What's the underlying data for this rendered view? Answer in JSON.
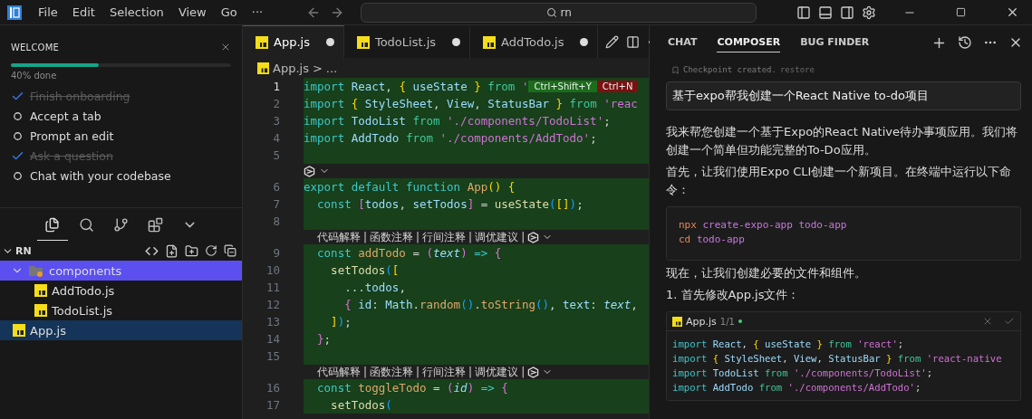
{
  "title_bar": {
    "menu": [
      "File",
      "Edit",
      "Selection",
      "View",
      "Go",
      "···"
    ],
    "search": {
      "value": "rn"
    }
  },
  "welcome": {
    "title": "WELCOME",
    "progress": {
      "level": 0.4,
      "reading": "40% done"
    },
    "tasks": [
      {
        "label": "Finish onboarding",
        "done": true
      },
      {
        "label": "Accept a tab",
        "done": false
      },
      {
        "label": "Prompt an edit",
        "done": false
      },
      {
        "label": "Ask a question",
        "done": true
      },
      {
        "label": "Chat with your codebase",
        "done": false
      }
    ]
  },
  "activity_tabs": [
    {
      "kind": "files",
      "selected": true
    },
    {
      "kind": "search",
      "selected": false
    },
    {
      "kind": "source-control",
      "selected": false
    },
    {
      "kind": "extensions",
      "selected": false
    },
    {
      "kind": "more",
      "selected": false
    }
  ],
  "explorer": {
    "title": "RN",
    "expanded": true,
    "tree": [
      {
        "label": "components",
        "kind": "folder",
        "expanded": true,
        "selected": true,
        "active": false,
        "children": [
          {
            "label": "AddTodo.js",
            "kind": "js",
            "selected": false,
            "active": false
          },
          {
            "label": "TodoList.js",
            "kind": "js",
            "selected": false,
            "active": false
          }
        ]
      },
      {
        "label": "App.js",
        "kind": "js",
        "selected": false,
        "active": true
      }
    ]
  },
  "editor": {
    "tabs": [
      {
        "label": "App.js",
        "selected": true,
        "modified": true
      },
      {
        "label": "TodoList.js",
        "selected": false,
        "modified": true
      },
      {
        "label": "AddTodo.js",
        "selected": false,
        "modified": true
      }
    ],
    "breadcrumb": {
      "file": "App.js",
      "separator": ">",
      "rest": "..."
    },
    "lines": [
      {
        "kind": "code",
        "number": "1",
        "current": true,
        "added": true,
        "tokens": [
          {
            "t": "import ",
            "kind": "kw"
          },
          {
            "t": "React",
            "kind": "id"
          },
          {
            "t": ", ",
            "kind": "plain"
          },
          {
            "t": "{ ",
            "kind": "p1"
          },
          {
            "t": "useState ",
            "kind": "id"
          },
          {
            "t": "} ",
            "kind": "p1"
          },
          {
            "t": "from ",
            "kind": "from"
          },
          {
            "t": "'",
            "kind": "str"
          }
        ],
        "badges": [
          {
            "label": "Ctrl+Shift+Y",
            "kind": "accept"
          },
          {
            "label": "Ctrl+N",
            "kind": "reject"
          }
        ]
      },
      {
        "kind": "code",
        "number": "2",
        "current": false,
        "added": true,
        "tokens": [
          {
            "t": "import ",
            "kind": "kw"
          },
          {
            "t": "{ ",
            "kind": "p1"
          },
          {
            "t": "StyleSheet",
            "kind": "id"
          },
          {
            "t": ", ",
            "kind": "plain"
          },
          {
            "t": "View",
            "kind": "id"
          },
          {
            "t": ", ",
            "kind": "plain"
          },
          {
            "t": "StatusBar ",
            "kind": "id"
          },
          {
            "t": "} ",
            "kind": "p1"
          },
          {
            "t": "from ",
            "kind": "from"
          },
          {
            "t": "'reac",
            "kind": "str"
          }
        ]
      },
      {
        "kind": "code",
        "number": "3",
        "current": false,
        "added": true,
        "tokens": [
          {
            "t": "import ",
            "kind": "kw"
          },
          {
            "t": "TodoList ",
            "kind": "id"
          },
          {
            "t": "from ",
            "kind": "from"
          },
          {
            "t": "'./components/TodoList'",
            "kind": "str"
          },
          {
            "t": ";",
            "kind": "plain"
          }
        ]
      },
      {
        "kind": "code",
        "number": "4",
        "current": false,
        "added": true,
        "tokens": [
          {
            "t": "import ",
            "kind": "kw"
          },
          {
            "t": "AddTodo ",
            "kind": "id"
          },
          {
            "t": "from ",
            "kind": "from"
          },
          {
            "t": "'./components/AddTodo'",
            "kind": "str"
          },
          {
            "t": ";",
            "kind": "plain"
          }
        ]
      },
      {
        "kind": "code",
        "number": "5",
        "current": false,
        "added": true
      },
      {
        "kind": "ai_marker"
      },
      {
        "kind": "code",
        "number": "6",
        "current": false,
        "added": true,
        "tokens": [
          {
            "t": "export default function ",
            "kind": "kw"
          },
          {
            "t": "App",
            "kind": "fn"
          },
          {
            "t": "() {",
            "kind": "p1"
          }
        ]
      },
      {
        "kind": "code",
        "number": "7",
        "current": false,
        "added": true,
        "tokens": [
          {
            "t": "  const ",
            "kind": "kw"
          },
          {
            "t": "[",
            "kind": "p2"
          },
          {
            "t": "todos",
            "kind": "id"
          },
          {
            "t": ", ",
            "kind": "plain"
          },
          {
            "t": "setTodos",
            "kind": "id"
          },
          {
            "t": "]",
            "kind": "p2"
          },
          {
            "t": " = ",
            "kind": "plain"
          },
          {
            "t": "useState",
            "kind": "call"
          },
          {
            "t": "(",
            "kind": "p3"
          },
          {
            "t": "[]",
            "kind": "p1"
          },
          {
            "t": ")",
            "kind": "p3"
          },
          {
            "t": ";",
            "kind": "plain"
          }
        ]
      },
      {
        "kind": "code",
        "number": "8",
        "current": false,
        "added": true
      },
      {
        "kind": "lens",
        "links": [
          "代码解释",
          "函数注释",
          "行间注释",
          "调优建议"
        ],
        "separator": "|"
      },
      {
        "kind": "code",
        "number": "9",
        "current": false,
        "added": true,
        "tokens": [
          {
            "t": "  const ",
            "kind": "kw"
          },
          {
            "t": "addTodo",
            "kind": "fn"
          },
          {
            "t": " = ",
            "kind": "plain"
          },
          {
            "t": "(",
            "kind": "p2"
          },
          {
            "t": "text",
            "kind": "param"
          },
          {
            "t": ")",
            "kind": "p2"
          },
          {
            "t": " => ",
            "kind": "kw"
          },
          {
            "t": "{",
            "kind": "p2"
          }
        ]
      },
      {
        "kind": "code",
        "number": "10",
        "current": false,
        "added": true,
        "tokens": [
          {
            "t": "    setTodos",
            "kind": "call"
          },
          {
            "t": "(",
            "kind": "p3"
          },
          {
            "t": "[",
            "kind": "p1"
          }
        ]
      },
      {
        "kind": "code",
        "number": "11",
        "current": false,
        "added": true,
        "tokens": [
          {
            "t": "      ...",
            "kind": "plain"
          },
          {
            "t": "todos",
            "kind": "id"
          },
          {
            "t": ",",
            "kind": "plain"
          }
        ]
      },
      {
        "kind": "code",
        "number": "12",
        "current": false,
        "added": true,
        "tokens": [
          {
            "t": "      { ",
            "kind": "p2"
          },
          {
            "t": "id",
            "kind": "id"
          },
          {
            "t": ": ",
            "kind": "plain"
          },
          {
            "t": "Math",
            "kind": "id"
          },
          {
            "t": ".",
            "kind": "plain"
          },
          {
            "t": "random",
            "kind": "fn"
          },
          {
            "t": "()",
            "kind": "p3"
          },
          {
            "t": ".",
            "kind": "plain"
          },
          {
            "t": "toString",
            "kind": "fn"
          },
          {
            "t": "()",
            "kind": "p3"
          },
          {
            "t": ", ",
            "kind": "plain"
          },
          {
            "t": "text",
            "kind": "id"
          },
          {
            "t": ": ",
            "kind": "plain"
          },
          {
            "t": "text",
            "kind": "param"
          },
          {
            "t": ",",
            "kind": "plain"
          }
        ]
      },
      {
        "kind": "code",
        "number": "13",
        "current": false,
        "added": true,
        "tokens": [
          {
            "t": "    ]",
            "kind": "p1"
          },
          {
            "t": ")",
            "kind": "p3"
          },
          {
            "t": ";",
            "kind": "plain"
          }
        ]
      },
      {
        "kind": "code",
        "number": "14",
        "current": false,
        "added": true,
        "tokens": [
          {
            "t": "  }",
            "kind": "p2"
          },
          {
            "t": ";",
            "kind": "plain"
          }
        ]
      },
      {
        "kind": "code",
        "number": "15",
        "current": false,
        "added": true
      },
      {
        "kind": "lens",
        "links": [
          "代码解释",
          "函数注释",
          "行间注释",
          "调优建议"
        ],
        "separator": "|"
      },
      {
        "kind": "code",
        "number": "16",
        "current": false,
        "added": true,
        "tokens": [
          {
            "t": "  const ",
            "kind": "kw"
          },
          {
            "t": "toggleTodo",
            "kind": "fn"
          },
          {
            "t": " = ",
            "kind": "plain"
          },
          {
            "t": "(",
            "kind": "p2"
          },
          {
            "t": "id",
            "kind": "param"
          },
          {
            "t": ")",
            "kind": "p2"
          },
          {
            "t": " => ",
            "kind": "kw"
          },
          {
            "t": "{",
            "kind": "p2"
          }
        ]
      },
      {
        "kind": "code",
        "number": "17",
        "current": false,
        "added": true,
        "tokens": [
          {
            "t": "    setTodos",
            "kind": "call"
          },
          {
            "t": "(",
            "kind": "p3"
          }
        ]
      }
    ]
  },
  "side_panel": {
    "tabs": [
      {
        "label": "CHAT",
        "selected": false
      },
      {
        "label": "COMPOSER",
        "selected": true
      },
      {
        "label": "BUG FINDER",
        "selected": false
      }
    ],
    "checkpoint": {
      "text": "Checkpoint created.",
      "link": "restore"
    },
    "prompt": "基于expo帮我创建一个React Native to-do项目",
    "messages": [
      {
        "kind": "paragraph",
        "text": "我来帮您创建一个基于Expo的React Native待办事项应用。我们将创建一个简单但功能完整的To-Do应用。"
      },
      {
        "kind": "paragraph",
        "text": "首先，让我们使用Expo CLI创建一个新项目。在终端中运行以下命令："
      },
      {
        "kind": "code",
        "lines": [
          [
            {
              "t": "npx ",
              "kind": "cmd"
            },
            {
              "t": "create-expo-app todo-app",
              "kind": "arg"
            }
          ],
          [
            {
              "t": "cd ",
              "kind": "cmd"
            },
            {
              "t": "todo-app",
              "kind": "arg"
            }
          ]
        ]
      },
      {
        "kind": "paragraph",
        "text": "现在，让我们创建必要的文件和组件。"
      },
      {
        "kind": "paragraph",
        "text": "1. 首先修改App.js文件："
      },
      {
        "kind": "file",
        "name": "App.js",
        "count": "1/1",
        "lines": [
          [
            {
              "t": "import ",
              "kind": "kw"
            },
            {
              "t": "React",
              "kind": "id"
            },
            {
              "t": ", ",
              "kind": "plain"
            },
            {
              "t": "{ ",
              "kind": "p1"
            },
            {
              "t": "useState ",
              "kind": "id"
            },
            {
              "t": "} ",
              "kind": "p1"
            },
            {
              "t": "from ",
              "kind": "from"
            },
            {
              "t": "'react'",
              "kind": "str"
            },
            {
              "t": ";",
              "kind": "plain"
            }
          ],
          [
            {
              "t": "import ",
              "kind": "kw"
            },
            {
              "t": "{ ",
              "kind": "p1"
            },
            {
              "t": "StyleSheet",
              "kind": "id"
            },
            {
              "t": ", ",
              "kind": "plain"
            },
            {
              "t": "View",
              "kind": "id"
            },
            {
              "t": ", ",
              "kind": "plain"
            },
            {
              "t": "StatusBar ",
              "kind": "id"
            },
            {
              "t": "} ",
              "kind": "p1"
            },
            {
              "t": "from ",
              "kind": "from"
            },
            {
              "t": "'react-native",
              "kind": "str"
            }
          ],
          [
            {
              "t": "import ",
              "kind": "kw"
            },
            {
              "t": "TodoList ",
              "kind": "id"
            },
            {
              "t": "from ",
              "kind": "from"
            },
            {
              "t": "'./components/TodoList'",
              "kind": "str"
            },
            {
              "t": ";",
              "kind": "plain"
            }
          ],
          [
            {
              "t": "import ",
              "kind": "kw"
            },
            {
              "t": "AddTodo ",
              "kind": "id"
            },
            {
              "t": "from ",
              "kind": "from"
            },
            {
              "t": "'./components/AddTodo'",
              "kind": "str"
            },
            {
              "t": ";",
              "kind": "plain"
            }
          ]
        ]
      }
    ]
  }
}
